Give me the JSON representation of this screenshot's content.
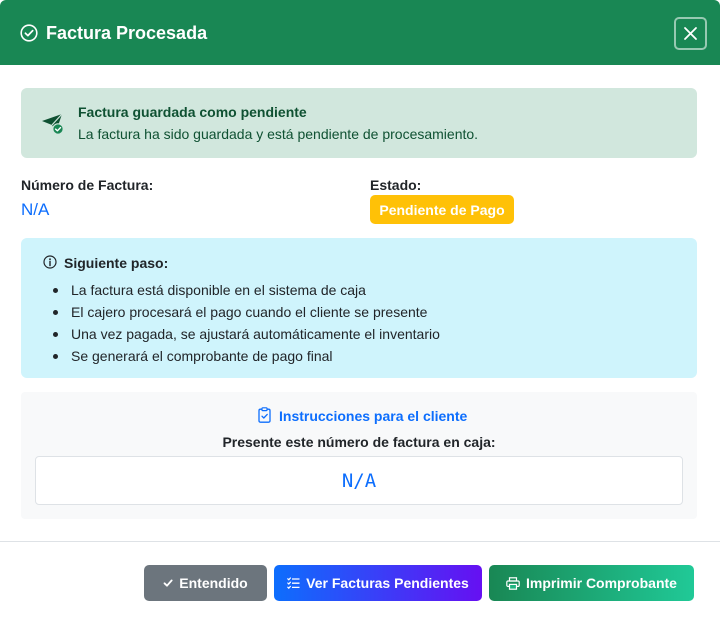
{
  "modal": {
    "title": "Factura Procesada",
    "close_icon": "close-icon",
    "header_color": "#198754"
  },
  "success_alert": {
    "icon": "send-check-icon",
    "title": "Factura guardada como pendiente",
    "text": "La factura ha sido guardada y está pendiente de procesamiento."
  },
  "invoice": {
    "number_label": "Número de Factura:",
    "number_value": "N/A",
    "status_label": "Estado:",
    "status_value": "Pendiente de Pago",
    "status_color": "#ffc107"
  },
  "next_step": {
    "icon": "info-circle-icon",
    "title": "Siguiente paso:",
    "items": [
      "La factura está disponible en el sistema de caja",
      "El cajero procesará el pago cuando el cliente se presente",
      "Una vez pagada, se ajustará automáticamente el inventario",
      "Se generará el comprobante de pago final"
    ]
  },
  "client": {
    "icon": "clipboard-check-icon",
    "title": "Instrucciones para el cliente",
    "subtitle": "Presente este número de factura en caja:",
    "number": "N/A"
  },
  "footer": {
    "ok_label": "Entendido",
    "pending_label": "Ver Facturas Pendientes",
    "print_label": "Imprimir Comprobante"
  }
}
